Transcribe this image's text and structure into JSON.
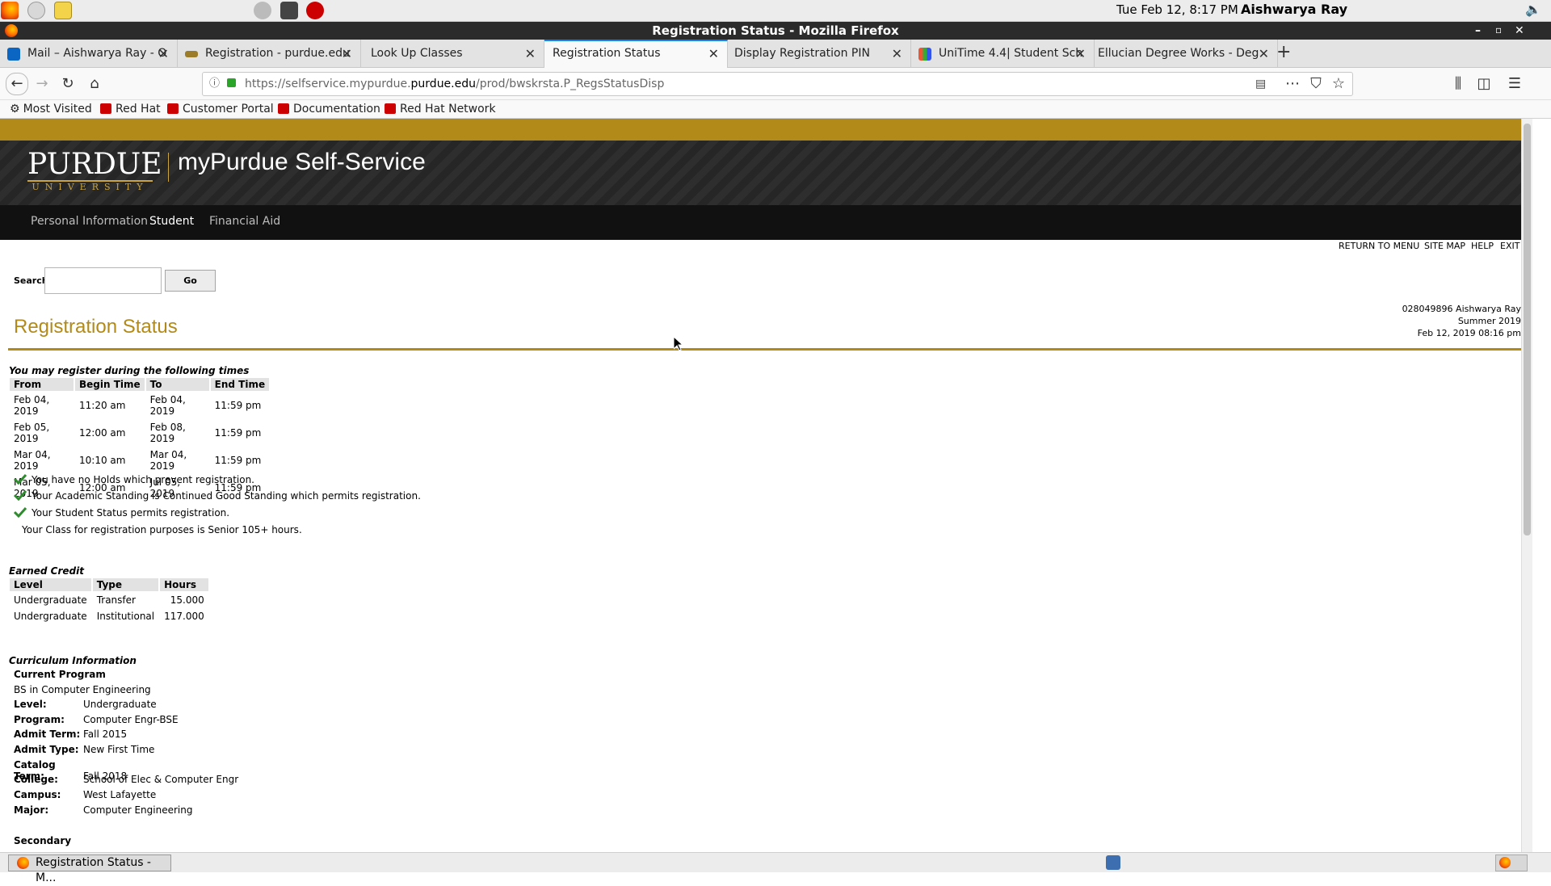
{
  "system": {
    "datetime": "Tue Feb 12,  8:17 PM",
    "user": "Aishwarya Ray"
  },
  "window": {
    "title": "Registration Status - Mozilla Firefox"
  },
  "tabs": [
    {
      "label": "Mail – Aishwarya Ray - O",
      "icon": "outlook-icon",
      "active": false
    },
    {
      "label": "Registration - purdue.edu",
      "icon": "purdue-icon",
      "active": false
    },
    {
      "label": "Look Up Classes",
      "icon": "",
      "active": false
    },
    {
      "label": "Registration Status",
      "icon": "",
      "active": true
    },
    {
      "label": "Display Registration PIN",
      "icon": "",
      "active": false
    },
    {
      "label": "UniTime 4.4| Student Sch",
      "icon": "unitime-icon",
      "active": false
    },
    {
      "label": "Ellucian Degree Works - Deg",
      "icon": "",
      "active": false
    }
  ],
  "urlbar": {
    "prefix": "https://selfservice.mypurdue.",
    "domain": "purdue.edu",
    "suffix": "/prod/bwskrsta.P_RegsStatusDisp"
  },
  "bookmarks": [
    "Most Visited",
    "Red Hat",
    "Customer Portal",
    "Documentation",
    "Red Hat Network"
  ],
  "site": {
    "logo_main": "PURDUE",
    "logo_sub": "UNIVERSITY",
    "title": "myPurdue Self-Service",
    "menu": [
      "Personal Information",
      "Student",
      "Financial Aid"
    ],
    "top_links": [
      "RETURN TO MENU",
      "SITE MAP",
      "HELP",
      "EXIT"
    ]
  },
  "search": {
    "label": "Search",
    "value": "",
    "button": "Go"
  },
  "page": {
    "title": "Registration Status",
    "info_line1": "028049896 Aishwarya Ray",
    "info_line2": "Summer 2019",
    "info_line3": "Feb 12, 2019 08:16 pm"
  },
  "times": {
    "caption": "You may register during the following times",
    "headers": [
      "From",
      "Begin Time",
      "To",
      "End Time"
    ],
    "rows": [
      [
        "Feb 04, 2019",
        "11:20 am",
        "Feb 04, 2019",
        "11:59 pm"
      ],
      [
        "Feb 05, 2019",
        "12:00 am",
        "Feb 08, 2019",
        "11:59 pm"
      ],
      [
        "Mar 04, 2019",
        "10:10 am",
        "Mar 04, 2019",
        "11:59 pm"
      ],
      [
        "Mar 05, 2019",
        "12:00 am",
        "Jul 05, 2019",
        "11:59 pm"
      ]
    ]
  },
  "status": [
    {
      "text": "You have no Holds which prevent registration.",
      "check": true
    },
    {
      "text": "Your Academic Standing is Continued Good Standing which permits registration.",
      "check": true
    },
    {
      "text": "Your Student Status permits registration.",
      "check": true
    },
    {
      "text": "Your Class for registration purposes is Senior 105+ hours.",
      "check": false
    }
  ],
  "credit": {
    "caption": "Earned Credit",
    "headers": [
      "Level",
      "Type",
      "Hours"
    ],
    "rows": [
      [
        "Undergraduate",
        "Transfer",
        "15.000"
      ],
      [
        "Undergraduate",
        "Institutional",
        "117.000"
      ]
    ]
  },
  "curriculum": {
    "caption": "Curriculum Information",
    "current_label": "Current Program",
    "program_name": "BS in Computer Engineering",
    "fields": [
      {
        "label": "Level:",
        "value": "Undergraduate"
      },
      {
        "label": "Program:",
        "value": "Computer Engr-BSE"
      },
      {
        "label": "Admit Term:",
        "value": "Fall 2015"
      },
      {
        "label": "Admit Type:",
        "value": "New First Time"
      },
      {
        "label": "Catalog Term:",
        "value": "Fall 2018"
      },
      {
        "label": "College:",
        "value": "School of Elec & Computer Engr"
      },
      {
        "label": "Campus:",
        "value": "West Lafayette"
      },
      {
        "label": "Major:",
        "value": "Computer Engineering"
      }
    ],
    "secondary_label": "Secondary"
  },
  "taskbar": {
    "item": "Registration Status - M..."
  }
}
